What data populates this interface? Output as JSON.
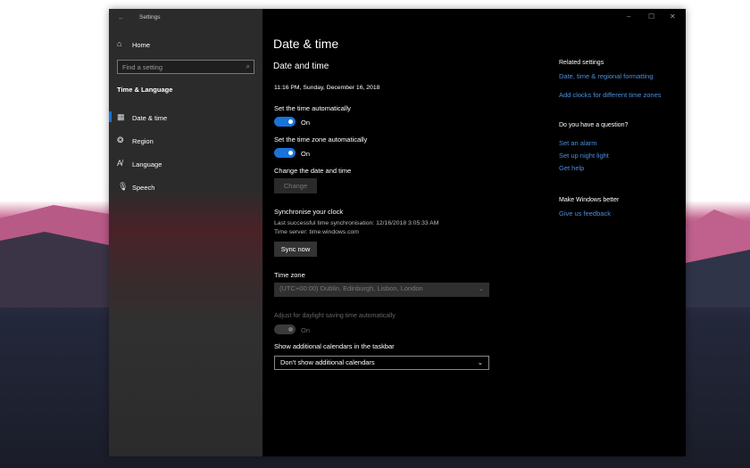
{
  "window": {
    "title": "Settings",
    "minimize": "–",
    "maximize": "☐",
    "close": "✕",
    "back": "←"
  },
  "sidebar": {
    "home": "Home",
    "search_placeholder": "Find a setting",
    "section": "Time & Language",
    "items": [
      {
        "label": "Date & time",
        "icon": "calendar-clock-icon"
      },
      {
        "label": "Region",
        "icon": "globe-icon"
      },
      {
        "label": "Language",
        "icon": "language-icon"
      },
      {
        "label": "Speech",
        "icon": "microphone-icon"
      }
    ]
  },
  "main": {
    "page_title": "Date & time",
    "section_title": "Date and time",
    "current_datetime": "11:16 PM, Sunday, December 16, 2018",
    "set_time_auto": {
      "label": "Set the time automatically",
      "state": "On"
    },
    "set_tz_auto": {
      "label": "Set the time zone automatically",
      "state": "On"
    },
    "change_label": "Change the date and time",
    "change_button": "Change",
    "sync_title": "Synchronise your clock",
    "last_sync": "Last successful time synchronisation: 12/16/2018 3:05:33 AM",
    "time_server": "Time server: time.windows.com",
    "sync_button": "Sync now",
    "timezone_label": "Time zone",
    "timezone_value": "(UTC+00:00) Dublin, Edinburgh, Lisbon, London",
    "dst": {
      "label": "Adjust for daylight saving time automatically",
      "state": "On"
    },
    "calendars_label": "Show additional calendars in the taskbar",
    "calendars_value": "Don't show additional calendars"
  },
  "right": {
    "related_title": "Related settings",
    "related_links": [
      "Date, time & regional formatting",
      "Add clocks for different time zones"
    ],
    "question_title": "Do you have a question?",
    "question_links": [
      "Set an alarm",
      "Set up night light",
      "Get help"
    ],
    "better_title": "Make Windows better",
    "feedback": "Give us feedback"
  },
  "colors": {
    "accent": "#1a73d9",
    "link": "#4a8fe0"
  }
}
